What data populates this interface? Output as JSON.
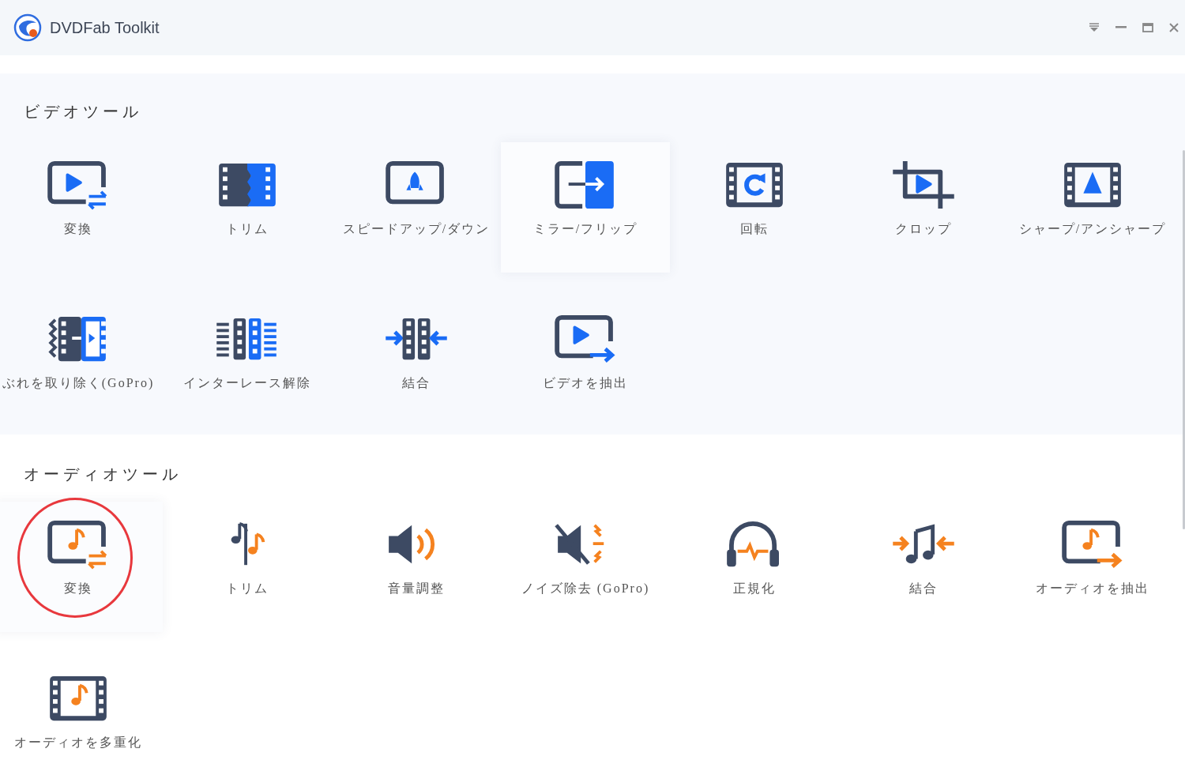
{
  "window": {
    "title": "DVDFab Toolkit"
  },
  "sections": [
    {
      "title": "ビデオツール",
      "tools": [
        {
          "label": "変換",
          "hovered": false,
          "circled": false
        },
        {
          "label": "トリム",
          "hovered": false,
          "circled": false
        },
        {
          "label": "スピードアップ/ダウン",
          "hovered": false,
          "circled": false
        },
        {
          "label": "ミラー/フリップ",
          "hovered": true,
          "circled": false
        },
        {
          "label": "回転",
          "hovered": false,
          "circled": false
        },
        {
          "label": "クロップ",
          "hovered": false,
          "circled": false
        },
        {
          "label": "シャープ/アンシャープ",
          "hovered": false,
          "circled": false
        },
        {
          "label": "ぶれを取り除く(GoPro)",
          "hovered": false,
          "circled": false
        },
        {
          "label": "インターレース解除",
          "hovered": false,
          "circled": false
        },
        {
          "label": "結合",
          "hovered": false,
          "circled": false
        },
        {
          "label": "ビデオを抽出",
          "hovered": false,
          "circled": false
        }
      ]
    },
    {
      "title": "オーディオツール",
      "tools": [
        {
          "label": "変換",
          "hovered": true,
          "circled": true
        },
        {
          "label": "トリム",
          "hovered": false,
          "circled": false
        },
        {
          "label": "音量調整",
          "hovered": false,
          "circled": false
        },
        {
          "label": "ノイズ除去 (GoPro)",
          "hovered": false,
          "circled": false
        },
        {
          "label": "正規化",
          "hovered": false,
          "circled": false
        },
        {
          "label": "結合",
          "hovered": false,
          "circled": false
        },
        {
          "label": "オーディオを抽出",
          "hovered": false,
          "circled": false
        },
        {
          "label": "オーディオを多重化",
          "hovered": false,
          "circled": false
        }
      ]
    }
  ]
}
